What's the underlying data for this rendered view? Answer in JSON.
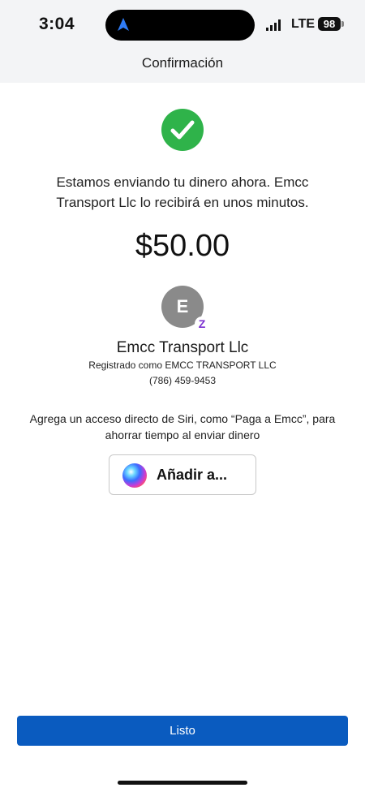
{
  "status_bar": {
    "time": "3:04",
    "network": "LTE",
    "battery": "98",
    "icons": [
      "location-arrow-icon",
      "signal-icon",
      "battery-icon"
    ]
  },
  "header": {
    "title": "Confirmación"
  },
  "confirmation": {
    "icon": "check-circle-icon",
    "message": "Estamos enviando tu dinero ahora. Emcc Transport Llc lo recibirá en unos minutos.",
    "amount": "$50.00"
  },
  "recipient": {
    "initial": "E",
    "badge": "Z",
    "name": "Emcc Transport Llc",
    "registered_as": "Registrado como EMCC TRANSPORT LLC",
    "phone": "(786) 459-9453"
  },
  "siri": {
    "prompt": "Agrega un acceso directo de Siri, como “Paga a Emcc”, para ahorrar tiempo al enviar dinero",
    "button_label": "Añadir a..."
  },
  "footer": {
    "done_label": "Listo"
  },
  "colors": {
    "success_green": "#2fb34a",
    "primary_blue": "#0a5bbf",
    "zelle_purple": "#7a2fd0",
    "header_bg": "#f3f4f6"
  }
}
